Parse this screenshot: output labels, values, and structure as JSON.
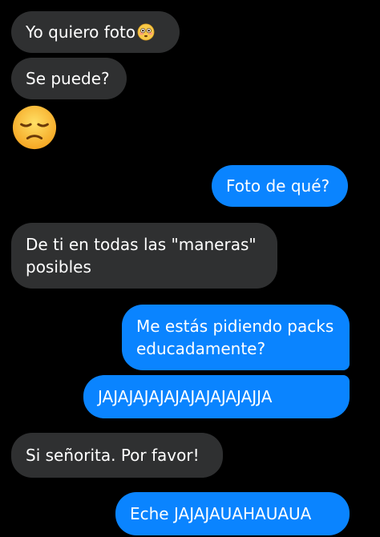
{
  "messages": [
    {
      "id": "m1",
      "side": "received",
      "text": "Yo quiero foto",
      "emoji": "flushed-face-emoji"
    },
    {
      "id": "m2",
      "side": "received",
      "text": "Se puede?"
    },
    {
      "id": "m3",
      "side": "received",
      "emoji": "pensive-face-emoji"
    },
    {
      "id": "m4",
      "side": "sent",
      "text": "Foto de qué?"
    },
    {
      "id": "m5",
      "side": "received",
      "text": "De ti en todas las \"maneras\" posibles"
    },
    {
      "id": "m6",
      "side": "sent",
      "text": "Me estás pidiendo packs educadamente?"
    },
    {
      "id": "m7",
      "side": "sent",
      "text": "JAJAJAJAJAJAJAJAJAJAJJA"
    },
    {
      "id": "m8",
      "side": "received",
      "text": "Si señorita. Por favor!"
    },
    {
      "id": "m9",
      "side": "sent",
      "text": "Eche JAJAJAUAHAUAUA"
    }
  ],
  "colors": {
    "background": "#000000",
    "received_bubble": "#2f3031",
    "sent_bubble": "#0a84ff",
    "text": "#ffffff"
  }
}
